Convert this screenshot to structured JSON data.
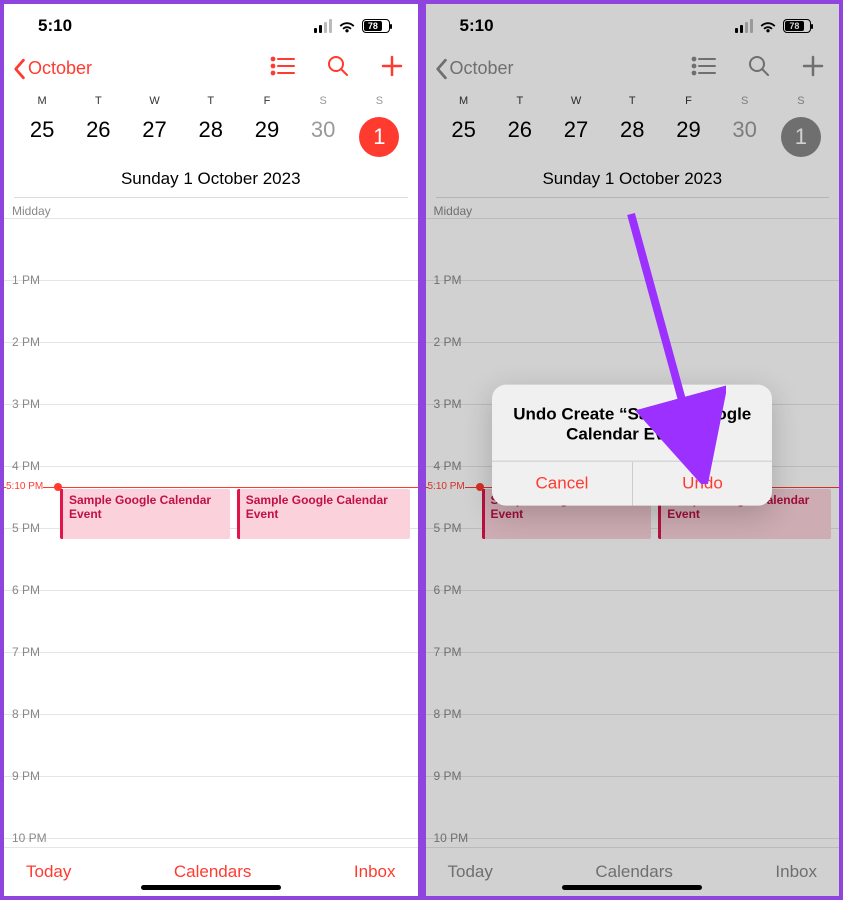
{
  "status": {
    "time": "5:10",
    "battery": "78"
  },
  "nav": {
    "back_label": "October"
  },
  "week": {
    "dow": [
      "M",
      "T",
      "W",
      "T",
      "F",
      "S",
      "S"
    ],
    "dates": [
      "25",
      "26",
      "27",
      "28",
      "29",
      "30",
      "1"
    ],
    "selected_index": 6,
    "full_date": "Sunday  1 October 2023"
  },
  "timeline": {
    "midday_label": "Midday",
    "hours": [
      "1 PM",
      "2 PM",
      "3 PM",
      "4 PM",
      "5 PM",
      "6 PM",
      "7 PM",
      "8 PM",
      "9 PM",
      "10 PM"
    ],
    "now_label": "5:10 PM",
    "events": [
      {
        "title": "Sample Google Calendar Event",
        "col": 0
      },
      {
        "title": "Sample Google Calendar Event",
        "col": 1
      }
    ]
  },
  "toolbar": {
    "today": "Today",
    "calendars": "Calendars",
    "inbox": "Inbox"
  },
  "alert": {
    "title": "Undo Create “Sample Google Calendar Event”",
    "cancel": "Cancel",
    "undo": "Undo"
  }
}
